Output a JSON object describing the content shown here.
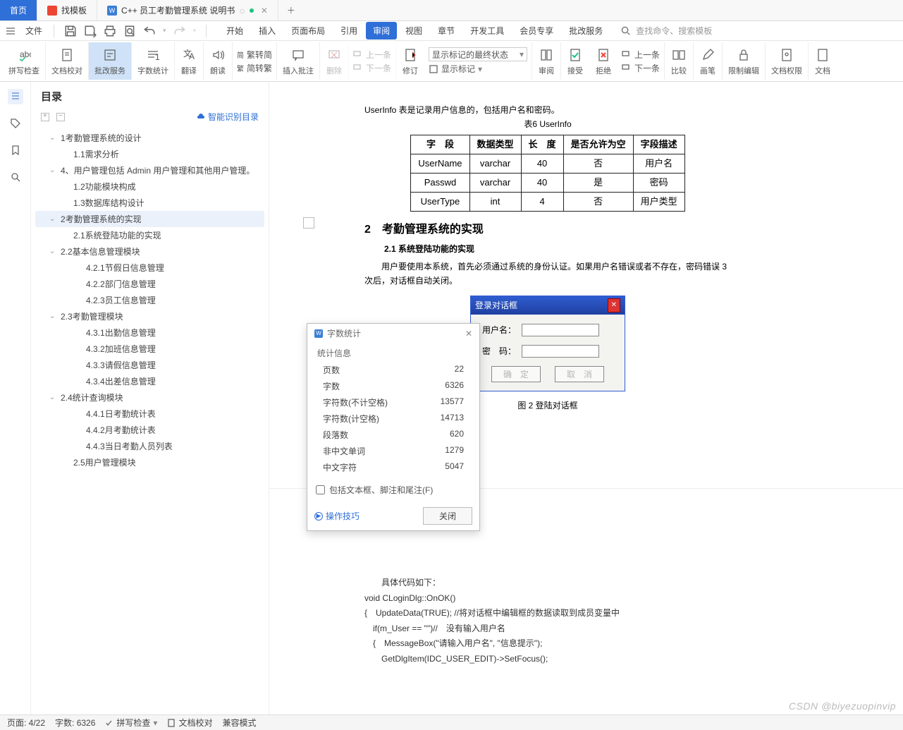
{
  "tabs": {
    "home": "首页",
    "tpl": "找模板",
    "doc": "C++ 员工考勤管理系统 说明书"
  },
  "menu": {
    "file": "文件",
    "search_placeholder": "查找命令、搜索模板",
    "items": [
      "开始",
      "插入",
      "页面布局",
      "引用",
      "审阅",
      "视图",
      "章节",
      "开发工具",
      "会员专享",
      "批改服务"
    ]
  },
  "ribbon": {
    "spell": "拼写检查",
    "proofread": "文档校对",
    "review": "批改服务",
    "wordcount": "字数统计",
    "translate": "翻译",
    "read": "朗读",
    "fanjian_t": "繁转简",
    "fanjian_s": "简转繁",
    "insert_comment": "插入批注",
    "delete": "删除",
    "prev": "上一条",
    "next": "下一条",
    "fix": "修订",
    "show_final": "显示标记的最终状态",
    "show_marks": "显示标记",
    "panel": "审阅",
    "accept": "接受",
    "reject": "拒绝",
    "nav_prev": "上一条",
    "nav_next": "下一条",
    "compare": "比较",
    "canvas": "画笔",
    "protect": "限制编辑",
    "docperm": "文档权限",
    "docmore": "文档"
  },
  "toc": {
    "title": "目录",
    "smart": "智能识别目录",
    "items": [
      {
        "t": "1考勤管理系统的设计",
        "lvl": 1,
        "arrow": "v"
      },
      {
        "t": "1.1需求分析",
        "lvl": 2
      },
      {
        "t": "4、用户管理包括 Admin 用户管理和其他用户管理。",
        "lvl": 1,
        "arrow": "v"
      },
      {
        "t": "1.2功能模块构成",
        "lvl": 2
      },
      {
        "t": "1.3数据库结构设计",
        "lvl": 2
      },
      {
        "t": "2考勤管理系统的实现",
        "lvl": 1,
        "arrow": "v",
        "sel": true
      },
      {
        "t": "2.1系统登陆功能的实现",
        "lvl": 2
      },
      {
        "t": "2.2基本信息管理模块",
        "lvl": 1,
        "arrow": "v"
      },
      {
        "t": "4.2.1节假日信息管理",
        "lvl": 3
      },
      {
        "t": "4.2.2部门信息管理",
        "lvl": 3
      },
      {
        "t": "4.2.3员工信息管理",
        "lvl": 3
      },
      {
        "t": "2.3考勤管理模块",
        "lvl": 1,
        "arrow": "v"
      },
      {
        "t": "4.3.1出勤信息管理",
        "lvl": 3
      },
      {
        "t": "4.3.2加班信息管理",
        "lvl": 3
      },
      {
        "t": "4.3.3请假信息管理",
        "lvl": 3
      },
      {
        "t": "4.3.4出差信息管理",
        "lvl": 3
      },
      {
        "t": "2.4统计查询模块",
        "lvl": 1,
        "arrow": "v"
      },
      {
        "t": "4.4.1日考勤统计表",
        "lvl": 3
      },
      {
        "t": "4.4.2月考勤统计表",
        "lvl": 3
      },
      {
        "t": "4.4.3当日考勤人员列表",
        "lvl": 3
      },
      {
        "t": "2.5用户管理模块",
        "lvl": 2
      }
    ]
  },
  "doc": {
    "p1": "UserInfo 表是记录用户信息的，包括用户名和密码。",
    "tcap": "表6 UserInfo",
    "th": [
      "字　段",
      "数据类型",
      "长　度",
      "是否允许为空",
      "字段描述"
    ],
    "rows": [
      [
        "UserName",
        "varchar",
        "40",
        "否",
        "用户名"
      ],
      [
        "Passwd",
        "varchar",
        "40",
        "是",
        "密码"
      ],
      [
        "UserType",
        "int",
        "4",
        "否",
        "用户类型"
      ]
    ],
    "h2": "2　考勤管理系统的实现",
    "h21": "2.1 系统登陆功能的实现",
    "p2": "用户要使用本系统，首先必须通过系统的身份认证。如果用户名错误或者不存在，密码错误 3 次后，对话框自动关闭。",
    "dlg": {
      "title": "登录对话框",
      "user": "用户名：",
      "pass": "密　码：",
      "ok": "确　定",
      "cancel": "取　消"
    },
    "figcap": "图 2 登陆对话框",
    "code_intro": "具体代码如下：",
    "code": [
      "void CLoginDlg::OnOK()",
      "{　UpdateData(TRUE); //将对话框中编辑框的数据读取到成员变量中",
      "　if(m_User == \"\")//　没有输入用户名",
      "　{　MessageBox(\"请输入用户名\", \"信息提示\");",
      "　　GetDlgItem(IDC_USER_EDIT)->SetFocus();"
    ]
  },
  "popup": {
    "title": "字数统计",
    "section": "统计信息",
    "rows": [
      [
        "页数",
        "22"
      ],
      [
        "字数",
        "6326"
      ],
      [
        "字符数(不计空格)",
        "13577"
      ],
      [
        "字符数(计空格)",
        "14713"
      ],
      [
        "段落数",
        "620"
      ],
      [
        "非中文单词",
        "1279"
      ],
      [
        "中文字符",
        "5047"
      ]
    ],
    "checkbox": "包括文本框、脚注和尾注(F)",
    "tip": "操作技巧",
    "close": "关闭"
  },
  "status": {
    "page": "页面: 4/22",
    "words": "字数: 6326",
    "spell": "拼写检查",
    "proof": "文档校对",
    "compat": "兼容模式"
  },
  "watermark": "CSDN @biyezuopinvip"
}
